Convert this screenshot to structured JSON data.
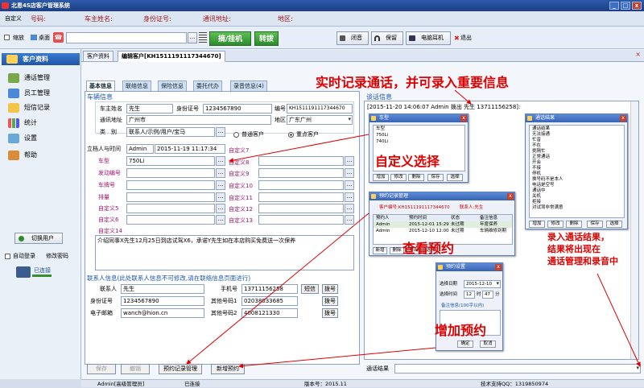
{
  "window": {
    "title": "北恩4S店客户管理系统",
    "min": "_",
    "max": "□",
    "close": "x"
  },
  "infobar": {
    "label": "自定义",
    "caller": "号码:",
    "owner": "车主姓名:",
    "idcard": "身份证号:",
    "address": "通讯地址:",
    "region": "地区:"
  },
  "toolbar": {
    "shrink": "缩放",
    "desktop": "桌面",
    "dots": "...",
    "pickup": "摘/挂机",
    "transfer": "转拨",
    "mute": "闭音",
    "hold": "保留",
    "pc_headset": "电脑耳机",
    "exit": "退出"
  },
  "sidebar": {
    "header": "客户资料",
    "items": [
      "通话管理",
      "员工管理",
      "短信记录",
      "统计",
      "设置",
      "帮助"
    ],
    "switch_user": "切换用户",
    "auto_login": "自动登录",
    "change_pwd": "修改密码",
    "connected": "已连接"
  },
  "tabs": [
    "客户资料",
    "编辑客户[KH1511191117344670]"
  ],
  "subtabs": [
    "基本信息",
    "联络信息",
    "保险信息",
    "委托代办",
    "录音信息(4)"
  ],
  "vehicle": {
    "section": "车辆信息",
    "owner_label": "车主姓名",
    "owner_value": "先生",
    "id_label": "身份证号",
    "id_value": "1234567890",
    "code_label": "编号",
    "code_value": "KH1511191117344670",
    "addr_label": "通讯地址",
    "addr_value": "广州市",
    "region_label": "地区",
    "region_value": "广东广州",
    "type_label": "类　别",
    "type_value": "联系人/示例/用户/宝马",
    "normal_customer": "普通客户",
    "key_customer": "重点客户",
    "creator_label": "立档人与时间",
    "creator_value": "Admin",
    "created_time": "2015-11-19 11:17:34",
    "car_model_label": "车型",
    "car_model_value": "750Li",
    "engine_label": "发动编号",
    "plate_label": "车牌号",
    "displacement_label": "排量",
    "custom_labels": [
      "自定义5",
      "自定义6",
      "自定义7",
      "自定义8",
      "自定义9",
      "自定义10",
      "自定义11",
      "自定义12",
      "自定义13",
      "自定义14"
    ],
    "notes": "介绍同事X先生12月25日到店试驾X6，承诺Y先生如在本店购买免费送一次保养"
  },
  "contact": {
    "section": "联系人信息(此处联系人信息不可修改,请在联络信息页面进行)",
    "name_label": "联系人",
    "name_value": "先生",
    "phone_label": "手机号",
    "phone_value": "13711156258",
    "id_label": "身份证号",
    "id_value": "1234567890",
    "other_phone_label": "其他号码1",
    "other_phone_value": "02038033685",
    "email_label": "电子邮箱",
    "email_value": "wanch@hion.cn",
    "other_phone2_label": "其他号码2",
    "other_phone2_value": "4008121330",
    "sms_btn": "短信",
    "dial_btn": "拨号"
  },
  "bottom_buttons": {
    "save": "保存",
    "cancel": "撤销",
    "appointments": "预约记录管理",
    "new_appt": "新增预约"
  },
  "call_info": {
    "section": "谈话信息",
    "first_line": "[2015-11-20 14:06:07 Admin 拨出 先生 13711156258]:",
    "result_label": "通话结果"
  },
  "dialogs": {
    "cartype": {
      "title": "车型",
      "header": "车型",
      "rows": [
        "750Li",
        "740Li"
      ],
      "buttons": [
        "增加",
        "修改",
        "删除",
        "保存",
        "选择"
      ]
    },
    "result": {
      "title": "通话结果",
      "header": "通话结果",
      "rows": [
        "无法接通",
        "忙音",
        "不在",
        "挑隔忙",
        "正常通话",
        "开会",
        "不接",
        "停机",
        "换号码不是本人",
        "电话是空号",
        "通话中",
        "关机",
        "拒接",
        "对试驾非常满意"
      ],
      "buttons": [
        "增加",
        "修改",
        "删除",
        "保存",
        "选择"
      ]
    },
    "appt_mgmt": {
      "title": "预约记录管理",
      "info": "客户编号:KH1511191117344670",
      "contact": "联系人:先生",
      "cols": [
        "预约人",
        "预约时间",
        "状态",
        "备注信息"
      ],
      "rows": [
        [
          "Admin",
          "2015-12-01 15:29",
          "未过期",
          "年度保养"
        ],
        [
          "Admin",
          "2015-12-10 12:00",
          "未过期",
          "车辆维修到期"
        ]
      ],
      "buttons": [
        "新增",
        "删除",
        "导出",
        "选择"
      ]
    },
    "appt_set": {
      "title": "预约设置",
      "date_label": "选择日期",
      "date_value": "2015-12-10",
      "time_label": "选择时间",
      "hour": "12",
      "hour_unit": "时",
      "minute": "47",
      "minute_unit": "分",
      "note_label": "备注信息(100字以内)",
      "ok": "确定",
      "cancel": "取消"
    }
  },
  "annotations": {
    "realtime": "实时记录通话，并可录入重要信息",
    "custom_select": "自定义选择",
    "view_appt": "查看预约",
    "add_appt": "增加预约",
    "record_result_1": "录入通话结果，",
    "record_result_2": "结果将出现在",
    "record_result_3": "通话管理和录音中"
  },
  "status": {
    "user": "Admin[高级管理员]",
    "conn": "已连接",
    "version": "版本号：2015.11",
    "support": "技术支持QQ：1319850974"
  },
  "colors": {
    "accent": "#1f57a8",
    "annotation": "#e00000"
  }
}
